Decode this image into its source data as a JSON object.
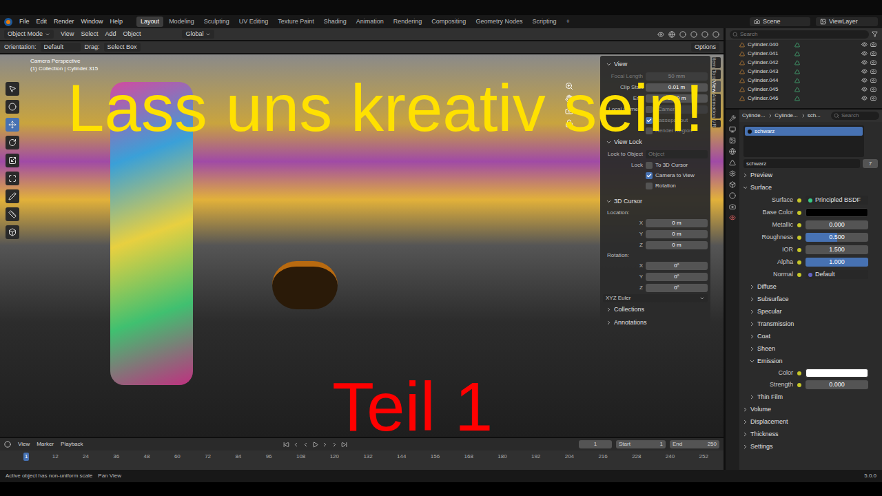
{
  "menu": [
    "File",
    "Edit",
    "Render",
    "Window",
    "Help"
  ],
  "workspaces": [
    {
      "label": "Layout",
      "selected": true
    },
    {
      "label": "Modeling",
      "selected": false
    },
    {
      "label": "Sculpting",
      "selected": false
    },
    {
      "label": "UV Editing",
      "selected": false
    },
    {
      "label": "Texture Paint",
      "selected": false
    },
    {
      "label": "Shading",
      "selected": false
    },
    {
      "label": "Animation",
      "selected": false
    },
    {
      "label": "Rendering",
      "selected": false
    },
    {
      "label": "Compositing",
      "selected": false
    },
    {
      "label": "Geometry Nodes",
      "selected": false
    },
    {
      "label": "Scripting",
      "selected": false
    },
    {
      "label": "+",
      "selected": false
    }
  ],
  "scene": "Scene",
  "view_layer": "ViewLayer",
  "viewport_header": {
    "mode": "Object Mode",
    "menus": [
      "View",
      "Select",
      "Add",
      "Object"
    ],
    "transform": "Global"
  },
  "tool_settings": {
    "orientation_label": "Orientation:",
    "orientation": "Default",
    "drag_label": "Drag:",
    "drag": "Select Box",
    "options": "Options"
  },
  "viewport": {
    "camera": "Camera Perspective",
    "collection": "(1) Collection | Cylinder.315"
  },
  "sidebar": {
    "tabs": [
      {
        "label": "Item",
        "selected": false
      },
      {
        "label": "Tool",
        "selected": false
      },
      {
        "label": "View",
        "selected": true
      },
      {
        "label": "Animation",
        "selected": false
      },
      {
        "label": "VR",
        "selected": false
      }
    ],
    "view": {
      "title": "View",
      "fields": [
        {
          "label": "Focal Length",
          "value": "50 mm",
          "disabled": true
        },
        {
          "label": "Clip Start",
          "value": "0.01 m",
          "disabled": false
        },
        {
          "label": "End",
          "value": "1000 m",
          "disabled": false
        }
      ],
      "local_camera": {
        "label": "Local Camera",
        "checked": false,
        "placeholder": "Camera"
      },
      "checks": [
        {
          "label": "Passepartout",
          "checked": true,
          "disabled": true
        },
        {
          "label": "Render Region",
          "checked": false,
          "disabled": true
        }
      ]
    },
    "view_lock": {
      "title": "View Lock",
      "lock_object_label": "Lock to Object",
      "lock_object_placeholder": "Object",
      "lock_label": "Lock",
      "checks": [
        {
          "label": "To 3D Cursor",
          "checked": false
        },
        {
          "label": "Camera to View",
          "checked": true
        },
        {
          "label": "Rotation",
          "checked": false
        }
      ]
    },
    "cursor": {
      "title": "3D Cursor",
      "location_label": "Location:",
      "location": [
        {
          "axis": "X",
          "value": "0 m"
        },
        {
          "axis": "Y",
          "value": "0 m"
        },
        {
          "axis": "Z",
          "value": "0 m"
        }
      ],
      "rotation_label": "Rotation:",
      "rotation": [
        {
          "axis": "X",
          "value": "0°"
        },
        {
          "axis": "Y",
          "value": "0°"
        },
        {
          "axis": "Z",
          "value": "0°"
        }
      ],
      "mode": "XYZ Euler"
    },
    "collapsed": [
      "Collections",
      "Annotations"
    ]
  },
  "timeline": {
    "menus": [
      "View",
      "Marker",
      "Playback"
    ],
    "current_frame": "1",
    "start_label": "Start",
    "start": "1",
    "end_label": "End",
    "end": "250",
    "ruler": [
      {
        "label": "1",
        "selected": true
      },
      {
        "label": "12",
        "selected": false
      },
      {
        "label": "24",
        "selected": false
      },
      {
        "label": "36",
        "selected": false
      },
      {
        "label": "48",
        "selected": false
      },
      {
        "label": "60",
        "selected": false
      },
      {
        "label": "72",
        "selected": false
      },
      {
        "label": "84",
        "selected": false
      },
      {
        "label": "96",
        "selected": false
      },
      {
        "label": "108",
        "selected": false
      },
      {
        "label": "120",
        "selected": false
      },
      {
        "label": "132",
        "selected": false
      },
      {
        "label": "144",
        "selected": false
      },
      {
        "label": "156",
        "selected": false
      },
      {
        "label": "168",
        "selected": false
      },
      {
        "label": "180",
        "selected": false
      },
      {
        "label": "192",
        "selected": false
      },
      {
        "label": "204",
        "selected": false
      },
      {
        "label": "216",
        "selected": false
      },
      {
        "label": "228",
        "selected": false
      },
      {
        "label": "240",
        "selected": false
      },
      {
        "label": "252",
        "selected": false
      }
    ]
  },
  "outliner": {
    "search_placeholder": "Search",
    "items": [
      "Cylinder.040",
      "Cylinder.041",
      "Cylinder.042",
      "Cylinder.043",
      "Cylinder.044",
      "Cylinder.045",
      "Cylinder.046"
    ]
  },
  "properties": {
    "breadcrumb": [
      "Cylinde...",
      "Cylinde...",
      "sch..."
    ],
    "search_placeholder": "Search",
    "slots": [
      {
        "name": "schwarz",
        "selected": true
      }
    ],
    "material": {
      "name": "schwarz",
      "users": "7"
    },
    "preview": "Preview",
    "surface_title": "Surface",
    "surface_rows": [
      {
        "kind": "dropdown",
        "label": "Surface",
        "value": "Principled BSDF"
      },
      {
        "kind": "color",
        "label": "Base Color",
        "color": "#000000"
      },
      {
        "kind": "slider",
        "label": "Metallic",
        "value": "0.000",
        "level": 0
      },
      {
        "kind": "slider",
        "label": "Roughness",
        "value": "0.500",
        "level": 0.5
      },
      {
        "kind": "number",
        "label": "IOR",
        "value": "1.500"
      },
      {
        "kind": "slider",
        "label": "Alpha",
        "value": "1.000",
        "level": 1
      },
      {
        "kind": "link",
        "label": "Normal",
        "value": "Default"
      }
    ],
    "subsections": [
      {
        "label": "Diffuse",
        "expanded": false,
        "rows": []
      },
      {
        "label": "Subsurface",
        "expanded": false,
        "rows": []
      },
      {
        "label": "Specular",
        "expanded": false,
        "rows": []
      },
      {
        "label": "Transmission",
        "expanded": false,
        "rows": []
      },
      {
        "label": "Coat",
        "expanded": false,
        "rows": []
      },
      {
        "label": "Sheen",
        "expanded": false,
        "rows": []
      },
      {
        "label": "Emission",
        "expanded": true,
        "rows": [
          {
            "kind": "color",
            "label": "Color",
            "color": "#ffffff"
          },
          {
            "kind": "slider",
            "label": "Strength",
            "value": "0.000",
            "level": 0
          }
        ]
      },
      {
        "label": "Thin Film",
        "expanded": false,
        "rows": []
      }
    ],
    "sections": [
      "Volume",
      "Displacement",
      "Thickness",
      "Settings"
    ]
  },
  "status_bar": {
    "message": "Active object has non-uniform scale",
    "hint": "Pan View",
    "version": "5.0.0"
  },
  "overlay": {
    "title": "Lass uns kreativ sein!",
    "subtitle": "Teil 1"
  }
}
